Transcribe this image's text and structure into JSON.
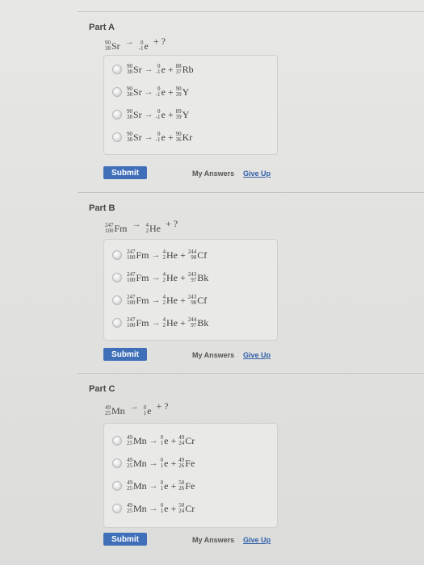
{
  "parts": [
    {
      "title": "Part A",
      "question": {
        "parent": {
          "mass": "90",
          "atomic": "38",
          "symbol": "Sr"
        },
        "known": {
          "mass": "0",
          "atomic": "-1",
          "symbol": "e"
        },
        "tail": "+ ?"
      },
      "choices": [
        {
          "parent": {
            "mass": "90",
            "atomic": "38",
            "symbol": "Sr"
          },
          "particle": {
            "mass": "0",
            "atomic": "-1",
            "symbol": "e"
          },
          "product": {
            "mass": "88",
            "atomic": "37",
            "symbol": "Rb"
          }
        },
        {
          "parent": {
            "mass": "90",
            "atomic": "38",
            "symbol": "Sr"
          },
          "particle": {
            "mass": "0",
            "atomic": "-1",
            "symbol": "e"
          },
          "product": {
            "mass": "90",
            "atomic": "39",
            "symbol": "Y"
          }
        },
        {
          "parent": {
            "mass": "90",
            "atomic": "38",
            "symbol": "Sr"
          },
          "particle": {
            "mass": "0",
            "atomic": "-1",
            "symbol": "e"
          },
          "product": {
            "mass": "89",
            "atomic": "39",
            "symbol": "Y"
          }
        },
        {
          "parent": {
            "mass": "90",
            "atomic": "38",
            "symbol": "Sr"
          },
          "particle": {
            "mass": "0",
            "atomic": "-1",
            "symbol": "e"
          },
          "product": {
            "mass": "90",
            "atomic": "36",
            "symbol": "Kr"
          }
        }
      ],
      "submit": "Submit",
      "my_answers": "My Answers",
      "give_up": "Give Up"
    },
    {
      "title": "Part B",
      "question": {
        "parent": {
          "mass": "247",
          "atomic": "100",
          "symbol": "Fm"
        },
        "known": {
          "mass": "4",
          "atomic": "2",
          "symbol": "He"
        },
        "tail": "+ ?"
      },
      "choices": [
        {
          "parent": {
            "mass": "247",
            "atomic": "100",
            "symbol": "Fm"
          },
          "particle": {
            "mass": "4",
            "atomic": "2",
            "symbol": "He"
          },
          "product": {
            "mass": "244",
            "atomic": "98",
            "symbol": "Cf"
          }
        },
        {
          "parent": {
            "mass": "247",
            "atomic": "100",
            "symbol": "Fm"
          },
          "particle": {
            "mass": "4",
            "atomic": "2",
            "symbol": "He"
          },
          "product": {
            "mass": "243",
            "atomic": "97",
            "symbol": "Bk"
          }
        },
        {
          "parent": {
            "mass": "247",
            "atomic": "100",
            "symbol": "Fm"
          },
          "particle": {
            "mass": "4",
            "atomic": "2",
            "symbol": "He"
          },
          "product": {
            "mass": "243",
            "atomic": "98",
            "symbol": "Cf"
          }
        },
        {
          "parent": {
            "mass": "247",
            "atomic": "100",
            "symbol": "Fm"
          },
          "particle": {
            "mass": "4",
            "atomic": "2",
            "symbol": "He"
          },
          "product": {
            "mass": "244",
            "atomic": "97",
            "symbol": "Bk"
          }
        }
      ],
      "submit": "Submit",
      "my_answers": "My Answers",
      "give_up": "Give Up"
    },
    {
      "title": "Part C",
      "question": {
        "parent": {
          "mass": "49",
          "atomic": "25",
          "symbol": "Mn"
        },
        "known": {
          "mass": "0",
          "atomic": "1",
          "symbol": "e"
        },
        "tail": "+ ?"
      },
      "choices": [
        {
          "parent": {
            "mass": "49",
            "atomic": "25",
            "symbol": "Mn"
          },
          "particle": {
            "mass": "0",
            "atomic": "1",
            "symbol": "e"
          },
          "product": {
            "mass": "49",
            "atomic": "24",
            "symbol": "Cr"
          }
        },
        {
          "parent": {
            "mass": "49",
            "atomic": "25",
            "symbol": "Mn"
          },
          "particle": {
            "mass": "0",
            "atomic": "1",
            "symbol": "e"
          },
          "product": {
            "mass": "49",
            "atomic": "26",
            "symbol": "Fe"
          }
        },
        {
          "parent": {
            "mass": "49",
            "atomic": "25",
            "symbol": "Mn"
          },
          "particle": {
            "mass": "0",
            "atomic": "1",
            "symbol": "e"
          },
          "product": {
            "mass": "50",
            "atomic": "26",
            "symbol": "Fe"
          }
        },
        {
          "parent": {
            "mass": "49",
            "atomic": "25",
            "symbol": "Mn"
          },
          "particle": {
            "mass": "0",
            "atomic": "1",
            "symbol": "e"
          },
          "product": {
            "mass": "50",
            "atomic": "24",
            "symbol": "Cr"
          }
        }
      ],
      "submit": "Submit",
      "my_answers": "My Answers",
      "give_up": "Give Up"
    }
  ],
  "colors": {
    "submit_bg": "#3f6fb8",
    "link": "#2f5fa8"
  }
}
